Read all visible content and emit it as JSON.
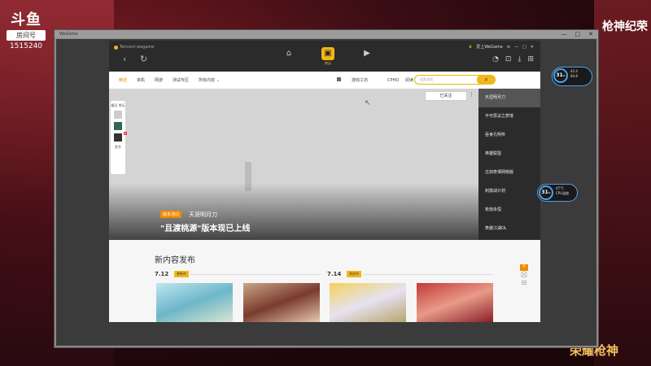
{
  "stream": {
    "platform_logo": "斗鱼",
    "room_label": "房间号",
    "room_id": "1515240",
    "title": "枪神纪荣",
    "bottom_logo": "荣耀枪神"
  },
  "outer_window": {
    "title": "WeGame"
  },
  "app": {
    "brand": "Tencent wegame",
    "top_tabs": [
      {
        "icon": "home-icon",
        "label": ""
      },
      {
        "icon": "store-icon",
        "label": "商店"
      },
      {
        "icon": "video-icon",
        "label": ""
      }
    ],
    "account_label": "爱上WeGame",
    "subnav": {
      "items": [
        "精选",
        "单机",
        "网游",
        "测试专区",
        "所有内容"
      ],
      "right_items": [
        "游戏工坊",
        "CPHD",
        "阅读"
      ],
      "search_placeholder": "搜索游戏"
    },
    "hero": {
      "followed_btn": "已关注",
      "side_panel_title": "最近\n常玩",
      "side_more": "更多",
      "tag": "版本活动",
      "sub": "天涯明月刀",
      "title": "\"且渡桃源\"版本现已上线"
    },
    "dropdown": [
      "天涯明月刀",
      "不可思议之梦境",
      "吞食孔明传",
      "英雄联盟",
      "古剑奇谭网络版",
      "刺激战计划",
      "枪炮永恒",
      "笑傲江湖OL"
    ],
    "content": {
      "heading": "新内容发布",
      "dates": [
        {
          "date": "7.12",
          "tag": "更新中"
        },
        {
          "date": "7.14",
          "tag": "测试中"
        }
      ],
      "mini_badge": "热"
    }
  },
  "overlays": {
    "stat1": {
      "value": "31",
      "unit": "%",
      "line1": "42.4",
      "line2": "84.8"
    },
    "stat2": {
      "value": "31",
      "unit": "%",
      "line1": "47°C",
      "line2": "CPU温度"
    }
  }
}
